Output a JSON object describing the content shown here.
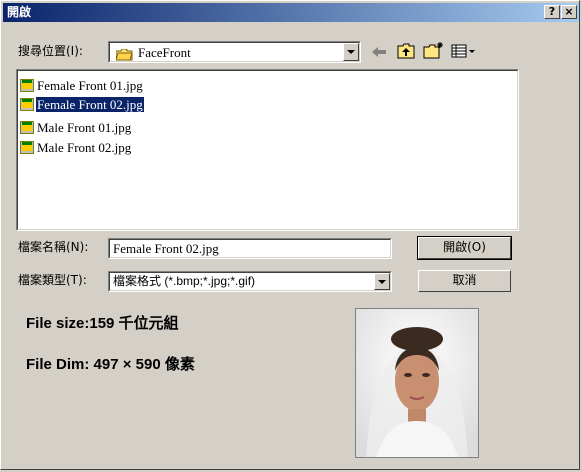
{
  "window": {
    "title": "開啟",
    "help_btn": "?",
    "close_btn": "×"
  },
  "lookin": {
    "label": "搜尋位置(I):",
    "value": "FaceFront"
  },
  "files": [
    {
      "name": "Female Front 01.jpg",
      "selected": false
    },
    {
      "name": "Female Front 02.jpg",
      "selected": true
    },
    {
      "name": "Male Front 01.jpg",
      "selected": false
    },
    {
      "name": "Male Front 02.jpg",
      "selected": false
    }
  ],
  "filename": {
    "label": "檔案名稱(N):",
    "value": "Female Front 02.jpg"
  },
  "filetype": {
    "label": "檔案類型(T):",
    "value": "檔案格式 (*.bmp;*.jpg;*.gif)"
  },
  "buttons": {
    "open": "開啟(O)",
    "cancel": "取消"
  },
  "info": {
    "file_size": "File size:159 千位元組",
    "file_dim": "File Dim: 497 × 590 像素"
  },
  "colors": {
    "title_start": "#0a246a",
    "title_end": "#a6caf0",
    "selection": "#0a246a",
    "face": "#d4d0c8"
  },
  "icons": [
    "folder-icon",
    "back-arrow-icon",
    "up-folder-icon",
    "new-folder-icon",
    "view-menu-icon",
    "jpg-file-icon"
  ]
}
